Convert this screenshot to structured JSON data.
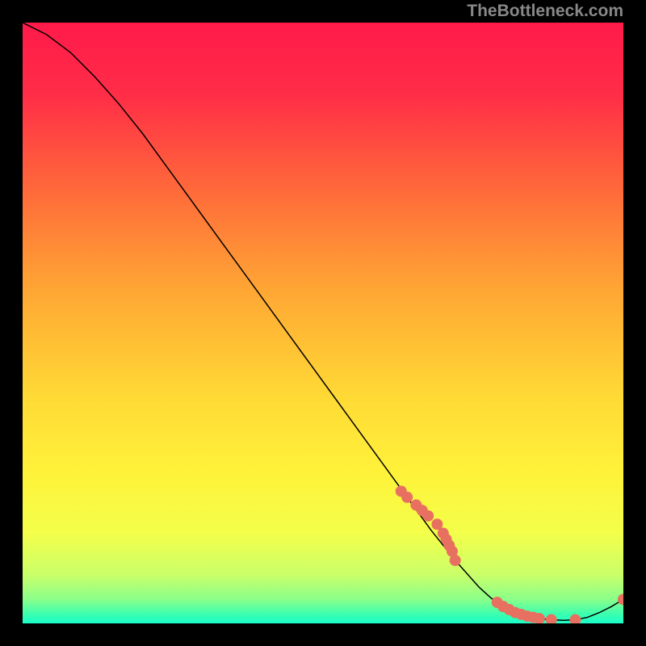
{
  "watermark": "TheBottleneck.com",
  "chart_data": {
    "type": "line",
    "title": "",
    "xlabel": "",
    "ylabel": "",
    "xlim": [
      0,
      100
    ],
    "ylim": [
      0,
      100
    ],
    "gradient_stops": [
      {
        "pos": 0.0,
        "color": "#ff1a4a"
      },
      {
        "pos": 0.12,
        "color": "#ff2d47"
      },
      {
        "pos": 0.28,
        "color": "#ff6a3a"
      },
      {
        "pos": 0.45,
        "color": "#ffa834"
      },
      {
        "pos": 0.62,
        "color": "#ffd935"
      },
      {
        "pos": 0.75,
        "color": "#fff23a"
      },
      {
        "pos": 0.85,
        "color": "#f3ff4a"
      },
      {
        "pos": 0.92,
        "color": "#c9ff6a"
      },
      {
        "pos": 0.96,
        "color": "#8aff8a"
      },
      {
        "pos": 0.985,
        "color": "#3affb0"
      },
      {
        "pos": 1.0,
        "color": "#1affc9"
      }
    ],
    "series": [
      {
        "name": "bottleneck-curve",
        "color": "#000000",
        "x": [
          0,
          4,
          8,
          12,
          16,
          20,
          24,
          28,
          32,
          36,
          40,
          44,
          48,
          52,
          56,
          60,
          64,
          68,
          72,
          76,
          78,
          80,
          82,
          84,
          86,
          88,
          90,
          92,
          94,
          96,
          98,
          100
        ],
        "y": [
          100,
          98,
          95,
          91,
          86.5,
          81.5,
          76,
          70.5,
          65,
          59.5,
          54,
          48.5,
          43,
          37.5,
          32,
          26.5,
          21,
          15.5,
          10.5,
          6,
          4.2,
          2.8,
          1.8,
          1.2,
          0.8,
          0.6,
          0.5,
          0.6,
          1.0,
          1.8,
          2.8,
          4.0
        ]
      }
    ],
    "markers": {
      "name": "data-points",
      "color": "#e87060",
      "radius": 7,
      "points": [
        {
          "x": 63,
          "y": 22.0
        },
        {
          "x": 64,
          "y": 21.0
        },
        {
          "x": 65.5,
          "y": 19.7
        },
        {
          "x": 66.5,
          "y": 18.8
        },
        {
          "x": 67.5,
          "y": 17.9
        },
        {
          "x": 69,
          "y": 16.5
        },
        {
          "x": 70,
          "y": 15.0
        },
        {
          "x": 70.5,
          "y": 14.0
        },
        {
          "x": 71,
          "y": 13.0
        },
        {
          "x": 71.5,
          "y": 12.0
        },
        {
          "x": 72,
          "y": 10.5
        },
        {
          "x": 79,
          "y": 3.5
        },
        {
          "x": 80,
          "y": 2.8
        },
        {
          "x": 81,
          "y": 2.3
        },
        {
          "x": 82,
          "y": 1.8
        },
        {
          "x": 83,
          "y": 1.5
        },
        {
          "x": 84,
          "y": 1.2
        },
        {
          "x": 85,
          "y": 1.0
        },
        {
          "x": 86,
          "y": 0.8
        },
        {
          "x": 88,
          "y": 0.6
        },
        {
          "x": 92,
          "y": 0.6
        },
        {
          "x": 100,
          "y": 4.0
        }
      ]
    }
  }
}
